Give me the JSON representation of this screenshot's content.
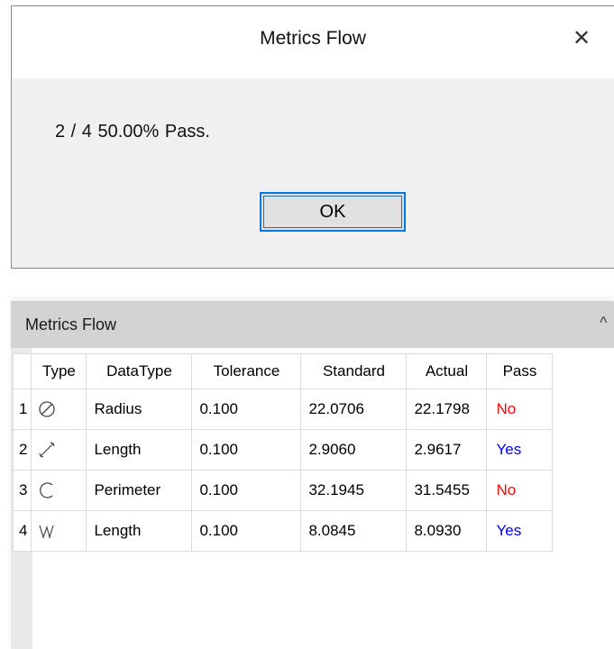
{
  "dialog": {
    "title": "Metrics Flow",
    "close_glyph": "✕",
    "message": "2 / 4  50.00% Pass.",
    "ok_label": "OK"
  },
  "panel": {
    "title": "Metrics Flow",
    "collapse_glyph": "^",
    "table": {
      "headers": {
        "index": "",
        "type": "Type",
        "datatype": "DataType",
        "tolerance": "Tolerance",
        "standard": "Standard",
        "actual": "Actual",
        "pass": "Pass"
      },
      "rows": [
        {
          "index": "1",
          "type_icon": "diameter-icon",
          "datatype": "Radius",
          "tolerance": "0.100",
          "standard": "22.0706",
          "actual": "22.1798",
          "pass": "No"
        },
        {
          "index": "2",
          "type_icon": "line-length-icon",
          "datatype": "Length",
          "tolerance": "0.100",
          "standard": "2.9060",
          "actual": "2.9617",
          "pass": "Yes"
        },
        {
          "index": "3",
          "type_icon": "arc-icon",
          "datatype": "Perimeter",
          "tolerance": "0.100",
          "standard": "32.1945",
          "actual": "31.5455",
          "pass": "No"
        },
        {
          "index": "4",
          "type_icon": "polyline-icon",
          "datatype": "Length",
          "tolerance": "0.100",
          "standard": "8.0845",
          "actual": "8.0930",
          "pass": "Yes"
        }
      ]
    }
  },
  "colors": {
    "pass_no": "#ff0000",
    "pass_yes": "#0000ff",
    "focus_border": "#0078d7",
    "panel_header": "#d3d3d3"
  }
}
